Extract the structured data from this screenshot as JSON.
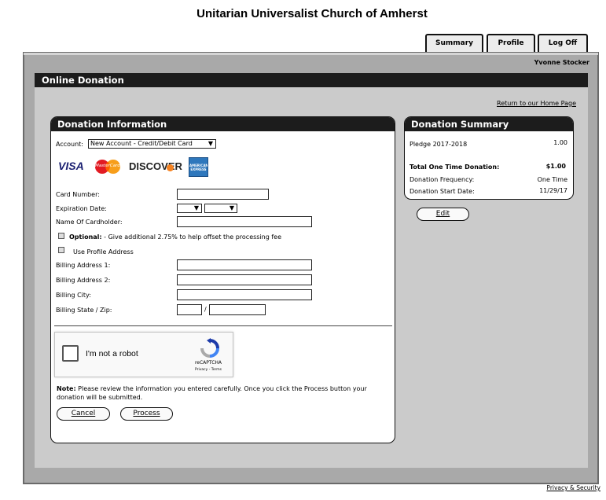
{
  "site": {
    "title": "Unitarian Universalist Church of Amherst"
  },
  "tabs": [
    {
      "label": "Summary"
    },
    {
      "label": "Profile"
    },
    {
      "label": "Log Off"
    }
  ],
  "user": {
    "name": "Yvonne Stocker"
  },
  "page": {
    "title": "Online Donation",
    "home_link": "Return to our Home Page"
  },
  "donation_info": {
    "title": "Donation Information",
    "account_label": "Account:",
    "account_value": "New Account - Credit/Debit Card",
    "cards": {
      "visa": "VISA",
      "mastercard": "MasterCard",
      "discover": "DISCOVER",
      "amex": "AMERICAN EXPRESS"
    },
    "card_number_label": "Card Number:",
    "expiration_label": "Expiration Date:",
    "cardholder_label": "Name Of Cardholder:",
    "optional_bold": "Optional:",
    "optional_text": " - Give additional 2.75% to help offset the processing fee",
    "use_profile_label": "Use Profile Address",
    "billing1_label": "Billing Address 1:",
    "billing2_label": "Billing Address 2:",
    "city_label": "Billing City:",
    "state_zip_label": "Billing State / Zip:",
    "zip_separator": "/",
    "captcha": {
      "label": "I'm not a robot",
      "brand": "reCAPTCHA",
      "links": "Privacy - Terms"
    },
    "note_bold": "Note:",
    "note_text": " Please review the information you entered carefully. Once you click the Process button your donation will be submitted.",
    "cancel_label": "Cancel",
    "process_label": "Process"
  },
  "summary": {
    "title": "Donation Summary",
    "pledge_label": "Pledge 2017-2018",
    "pledge_value": "1.00",
    "total_label": "Total One Time Donation:",
    "total_value": "$1.00",
    "frequency_label": "Donation Frequency:",
    "frequency_value": "One Time",
    "start_label": "Donation Start Date:",
    "start_value": "11/29/17",
    "edit_label": "Edit"
  },
  "footer": {
    "privacy_link": "Privacy & Security"
  },
  "colors": {
    "header_black": "#1c1c1c",
    "outer_grey": "#a9a9a9",
    "panel_grey": "#cbcbcb",
    "visa_blue": "#1a1f71",
    "amex_blue": "#2e77bc"
  }
}
